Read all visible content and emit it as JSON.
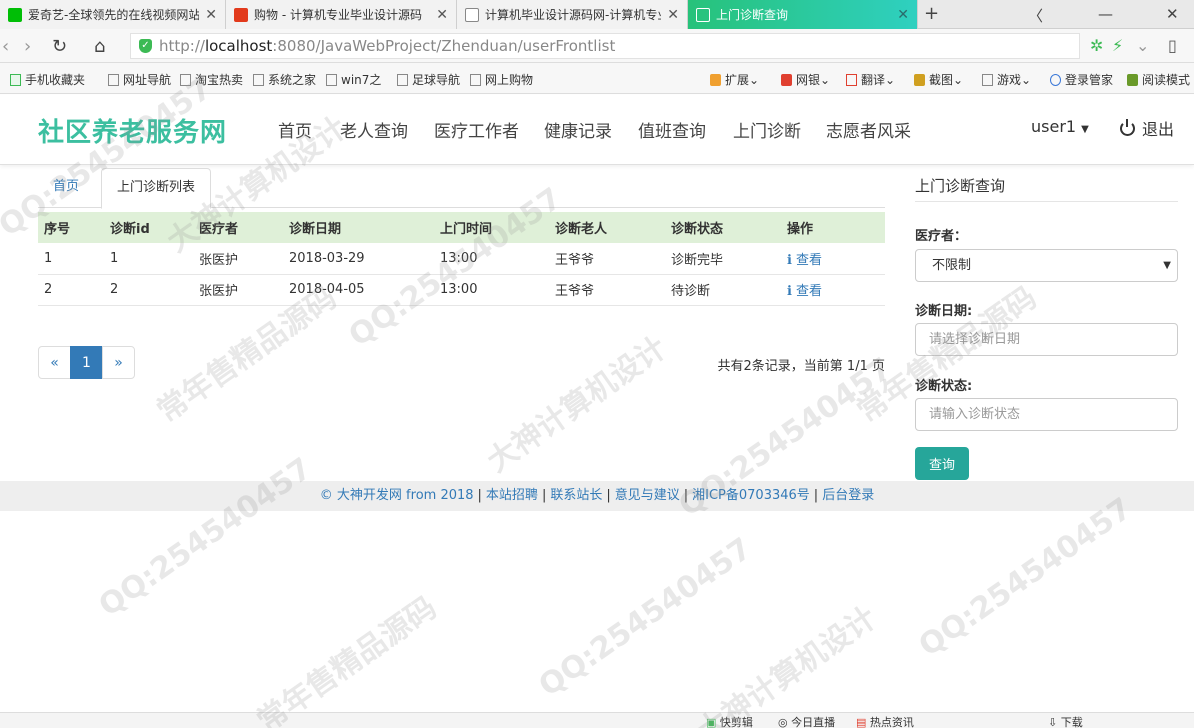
{
  "browser": {
    "tabs": [
      {
        "title": "爱奇艺-全球领先的在线视频网站",
        "favicon_color": "#00be06",
        "active": false
      },
      {
        "title": "购物 - 计算机专业毕业设计源码",
        "favicon_color": "#e23a1c",
        "active": false
      },
      {
        "title": "计算机毕业设计源码网-计算机专业",
        "favicon_color": "#888888",
        "active": false
      },
      {
        "title": "上门诊断查询",
        "favicon_color": "#ffffff",
        "active": true
      }
    ],
    "new_tab": "+",
    "url_prefix": "http://",
    "url_host": "localhost",
    "url_rest": ":8080/JavaWebProject/Zhenduan/userFrontlist",
    "bookmarks": [
      "手机收藏夹",
      "网址导航",
      "淘宝热卖",
      "系统之家",
      "win7之",
      "足球导航",
      "网上购物"
    ],
    "bookmarks_right": [
      "扩展",
      "网银",
      "翻译",
      "截图",
      "游戏",
      "登录管家",
      "阅读模式"
    ],
    "status_items": [
      "快剪辑",
      "今日直播",
      "热点资讯",
      "下载"
    ]
  },
  "site": {
    "brand": "社区养老服务网",
    "nav": [
      "首页",
      "老人查询",
      "医疗工作者",
      "健康记录",
      "值班查询",
      "上门诊断",
      "志愿者风采"
    ],
    "user": "user1",
    "logout": "退出",
    "accent_color": "#3cbfa0"
  },
  "breadcrumb": {
    "home": "首页",
    "current": "上门诊断列表"
  },
  "table": {
    "headers": [
      "序号",
      "诊断id",
      "医疗者",
      "诊断日期",
      "上门时间",
      "诊断老人",
      "诊断状态",
      "操作"
    ],
    "rows": [
      [
        "1",
        "1",
        "张医护",
        "2018-03-29",
        "13:00",
        "王爷爷",
        "诊断完毕",
        "查看"
      ],
      [
        "2",
        "2",
        "张医护",
        "2018-04-05",
        "13:00",
        "王爷爷",
        "待诊断",
        "查看"
      ]
    ]
  },
  "pager": {
    "prev": "«",
    "page": "1",
    "next": "»",
    "info": "共有2条记录，当前第 1/1 页"
  },
  "search": {
    "title": "上门诊断查询",
    "doctor_label": "医疗者：",
    "doctor_value": "不限制",
    "date_label": "诊断日期:",
    "date_placeholder": "请选择诊断日期",
    "status_label": "诊断状态:",
    "status_placeholder": "请输入诊断状态",
    "button": "查询"
  },
  "footer": {
    "links": [
      "© 大神开发网 from 2018",
      "本站招聘",
      "联系站长",
      "意见与建议",
      "湘ICP备0703346号",
      "后台登录"
    ]
  },
  "watermarks": [
    "QQ:254540457",
    "常年售精品源码",
    "大神计算机设计"
  ]
}
